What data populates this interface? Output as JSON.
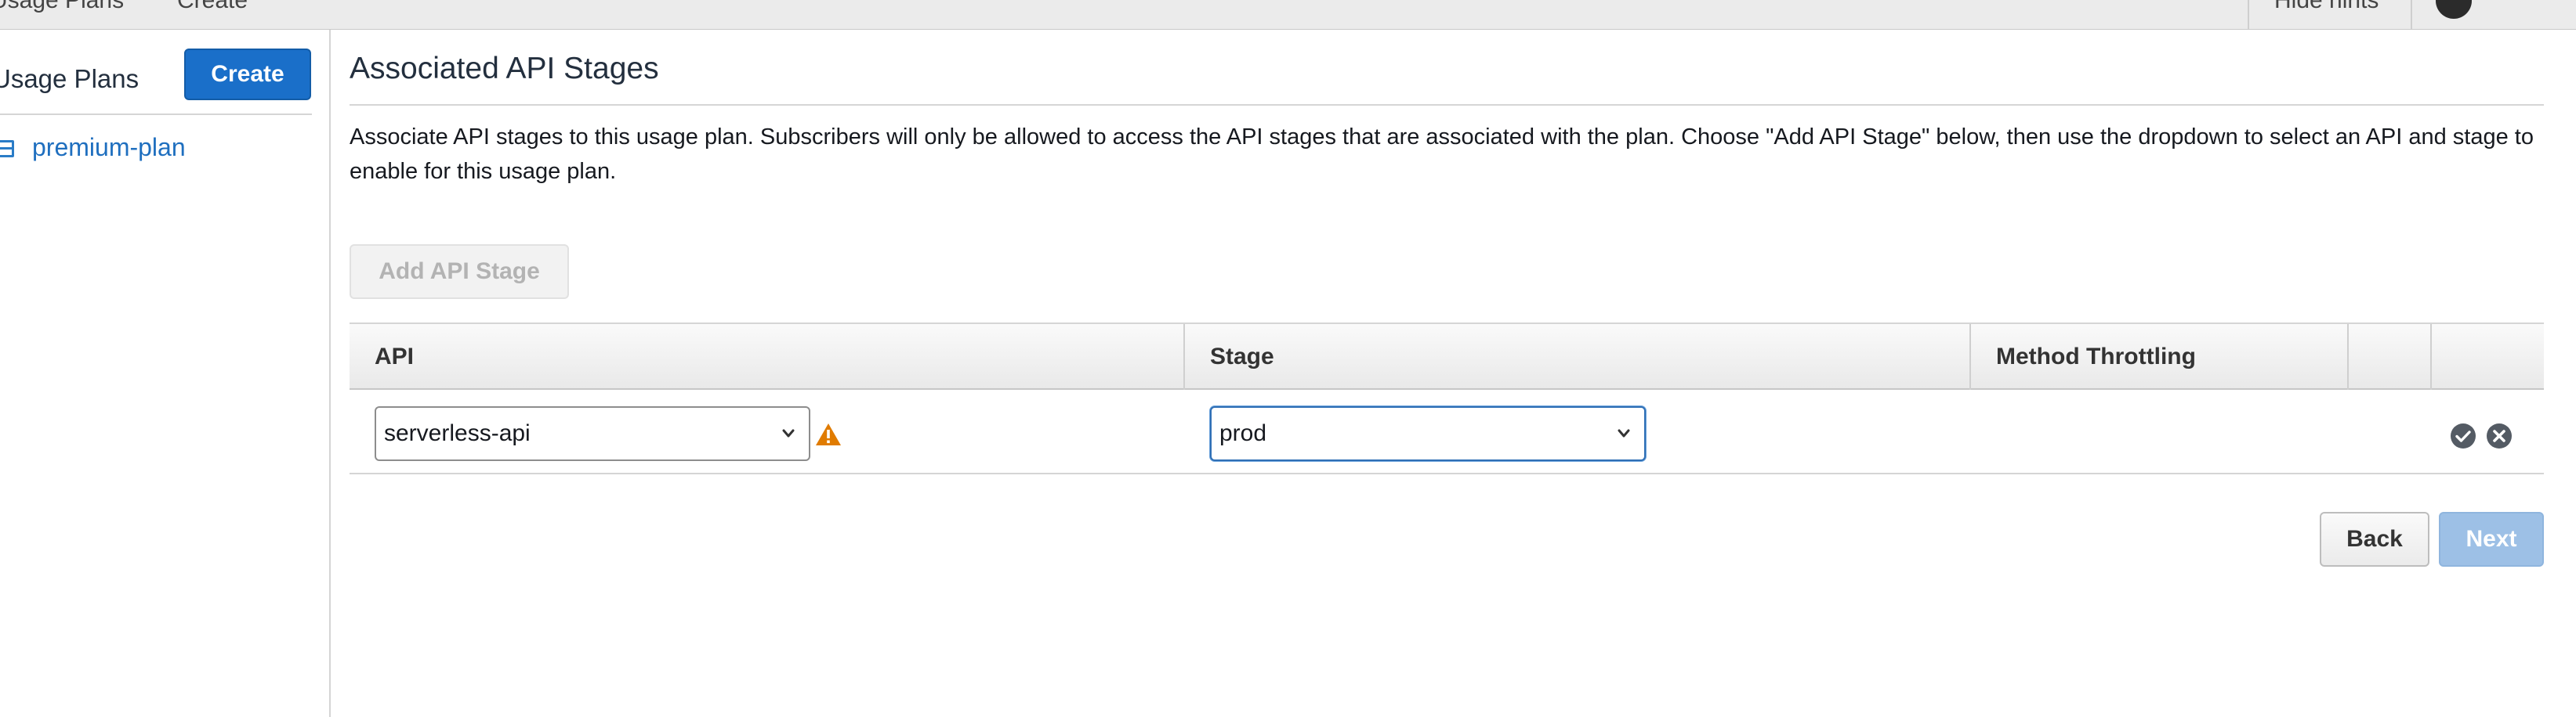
{
  "topbar": {
    "crumb_left": "Usage Plans",
    "crumb_create": "Create",
    "hide_hints": "Hide hints"
  },
  "sidebar": {
    "title": "Usage Plans",
    "create_label": "Create",
    "plans": [
      {
        "label": "premium-plan",
        "icon": "usage-plan-icon"
      }
    ]
  },
  "main": {
    "title": "Associated API Stages",
    "description": "Associate API stages to this usage plan. Subscribers will only be allowed to access the API stages that are associated with the plan. Choose \"Add API Stage\" below, then use the dropdown to select an API and stage to enable for this usage plan.",
    "add_stage_label": "Add API Stage",
    "table": {
      "columns": [
        "API",
        "Stage",
        "Method Throttling",
        "",
        ""
      ],
      "rows": [
        {
          "api": "serverless-api",
          "api_warning": true,
          "stage": "prod",
          "method_throttling": ""
        }
      ]
    },
    "back_label": "Back",
    "next_label": "Next"
  },
  "colors": {
    "primary_button": "#1a6fc9",
    "link": "#1f6fbf",
    "warning": "#e07b00",
    "disabled_primary": "#9dc0e6",
    "action_icon": "#545b64"
  }
}
